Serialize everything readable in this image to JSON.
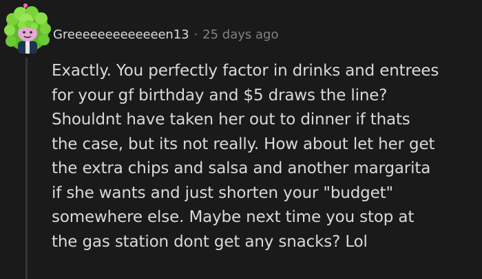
{
  "comment": {
    "username": "Greeeeeeeeeeeeen13",
    "separator": "·",
    "timestamp": "25 days ago",
    "avatar_icon": "green-haired-snoo-avatar-icon",
    "body_lines": [
      "Exactly. You perfectly factor in drinks and entrees",
      "for your gf birthday and $5 draws the line?",
      "Shouldnt have taken her out to dinner if thats",
      "the case, but its not really. How about let her get",
      "the extra chips and salsa and another margarita",
      "if she wants and just shorten your \"budget\"",
      "somewhere else. Maybe next time you stop at",
      "the gas station dont get any snacks? Lol"
    ]
  },
  "colors": {
    "background": "#1a1a1b",
    "text": "#d7dadc",
    "meta_text": "#818384",
    "thread_line": "#343536",
    "avatar_hair": "#7bd23b",
    "avatar_face": "#e8a7d8"
  }
}
